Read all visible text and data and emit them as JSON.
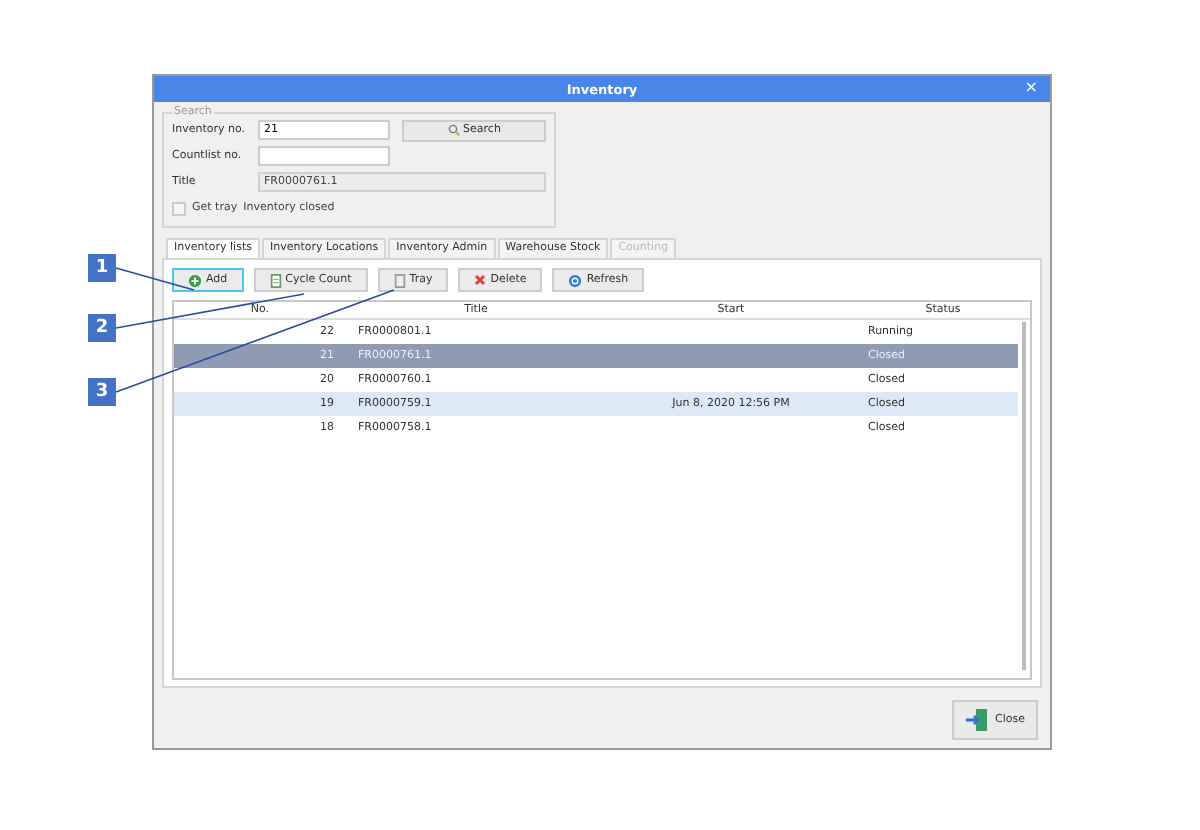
{
  "window": {
    "title": "Inventory",
    "close": "×"
  },
  "search": {
    "legend": "Search",
    "inventory_no": {
      "label": "Inventory no.",
      "value": "21"
    },
    "countlist_no": {
      "label": "Countlist no."
    },
    "title": {
      "label": "Title",
      "value": "FR0000761.1"
    },
    "search_button": "Search",
    "get_tray": {
      "label": "Get tray",
      "checked": false
    },
    "status_text": "Inventory closed"
  },
  "tabs": [
    {
      "label": "Inventory lists",
      "selected": true,
      "disabled": false
    },
    {
      "label": "Inventory Locations",
      "selected": false,
      "disabled": false
    },
    {
      "label": "Inventory Admin",
      "selected": false,
      "disabled": false
    },
    {
      "label": "Warehouse Stock",
      "selected": false,
      "disabled": false
    },
    {
      "label": "Counting",
      "selected": false,
      "disabled": true
    }
  ],
  "toolbar": [
    {
      "kind": "add",
      "label": "Add",
      "focused": true
    },
    {
      "kind": "cycle",
      "label": "Cycle Count",
      "focused": false
    },
    {
      "kind": "tray",
      "label": "Tray",
      "focused": false
    },
    {
      "kind": "delete",
      "label": "Delete",
      "focused": false
    },
    {
      "kind": "refresh",
      "label": "Refresh",
      "focused": false
    }
  ],
  "table": {
    "columns": [
      "No.",
      "Title",
      "Start",
      "Status"
    ],
    "rows": [
      {
        "cells": [
          "22",
          "FR0000801.1",
          "",
          "Running"
        ],
        "selected": false,
        "highlighted": false
      },
      {
        "cells": [
          "21",
          "FR0000761.1",
          "",
          "Closed"
        ],
        "selected": true,
        "highlighted": false
      },
      {
        "cells": [
          "20",
          "FR0000760.1",
          "",
          "Closed"
        ],
        "selected": false,
        "highlighted": false
      },
      {
        "cells": [
          "19",
          "FR0000759.1",
          "Jun 8, 2020 12:56 PM",
          "Closed"
        ],
        "selected": false,
        "highlighted": true
      },
      {
        "cells": [
          "18",
          "FR0000758.1",
          "",
          "Closed"
        ],
        "selected": false,
        "highlighted": false
      }
    ]
  },
  "close_button": "Close",
  "callouts": [
    "1",
    "2",
    "3"
  ]
}
